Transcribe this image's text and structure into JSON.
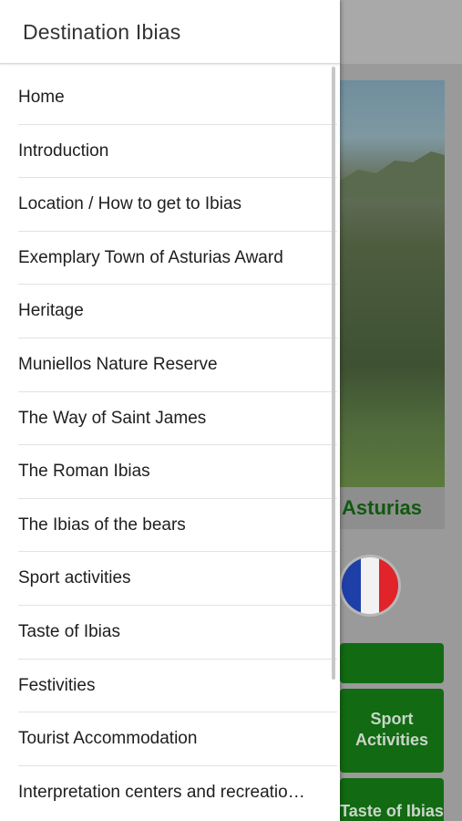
{
  "drawer": {
    "title": "Destination Ibias",
    "items": [
      {
        "label": "Home"
      },
      {
        "label": "Introduction"
      },
      {
        "label": "Location / How to get to Ibias"
      },
      {
        "label": "Exemplary Town of Asturias Award"
      },
      {
        "label": "Heritage"
      },
      {
        "label": "Muniellos Nature Reserve"
      },
      {
        "label": "The Way of Saint James"
      },
      {
        "label": "The Roman Ibias"
      },
      {
        "label": "The Ibias of the bears"
      },
      {
        "label": "Sport activities"
      },
      {
        "label": "Taste of Ibias"
      },
      {
        "label": "Festivities"
      },
      {
        "label": "Tourist Accommodation"
      },
      {
        "label": "Interpretation centers and recreatio…"
      }
    ]
  },
  "background": {
    "banner_text": "Asturias",
    "language_flag": "french-flag-icon",
    "tiles": [
      {
        "label": ""
      },
      {
        "label": "Sport Activities"
      },
      {
        "label": "Taste of Ibias"
      }
    ]
  },
  "colors": {
    "drawer_bg": "#ffffff",
    "tile_green": "#126a12",
    "banner_green": "#0f5a0f",
    "flag_blue": "#1f3fa8",
    "flag_red": "#e0242a"
  }
}
